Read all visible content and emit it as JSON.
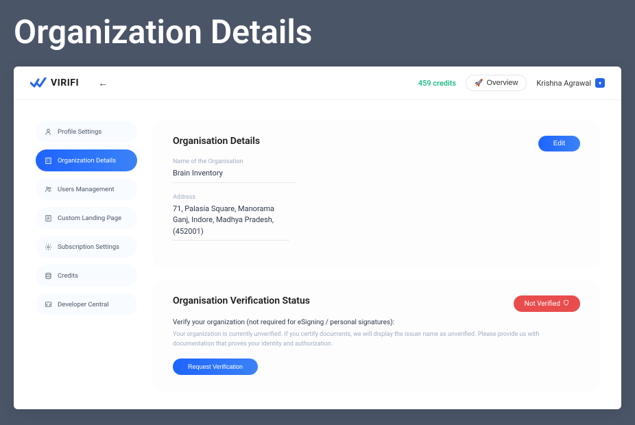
{
  "page_heading": "Organization Details",
  "topbar": {
    "logo_text": "VIRIFI",
    "credits": "459 credits",
    "overview_label": "Overview",
    "user_name": "Krishna Agrawal"
  },
  "sidebar": {
    "items": [
      {
        "label": "Profile Settings"
      },
      {
        "label": "Organization Details"
      },
      {
        "label": "Users Management"
      },
      {
        "label": "Custom Landing Page"
      },
      {
        "label": "Subscription Settings"
      },
      {
        "label": "Credits"
      },
      {
        "label": "Developer Central"
      }
    ]
  },
  "org_details": {
    "title": "Organisation Details",
    "edit_label": "Edit",
    "name_label": "Name of the Organisation",
    "name_value": "Brain Inventory",
    "address_label": "Address",
    "address_value": "71, Palasia Square, Manorama Ganj, Indore, Madhya Pradesh, (452001)"
  },
  "verification": {
    "title": "Organisation Verification Status",
    "status_badge": "Not Verified",
    "subtitle": "Verify your organization (not required for eSigning / personal signatures):",
    "body_text": "Your organization is currently unverified. If you certify documents, we will display the issuer name as unverified. Please provide us with documentation that proves your identity and authorization.",
    "request_label": "Request Verification"
  }
}
